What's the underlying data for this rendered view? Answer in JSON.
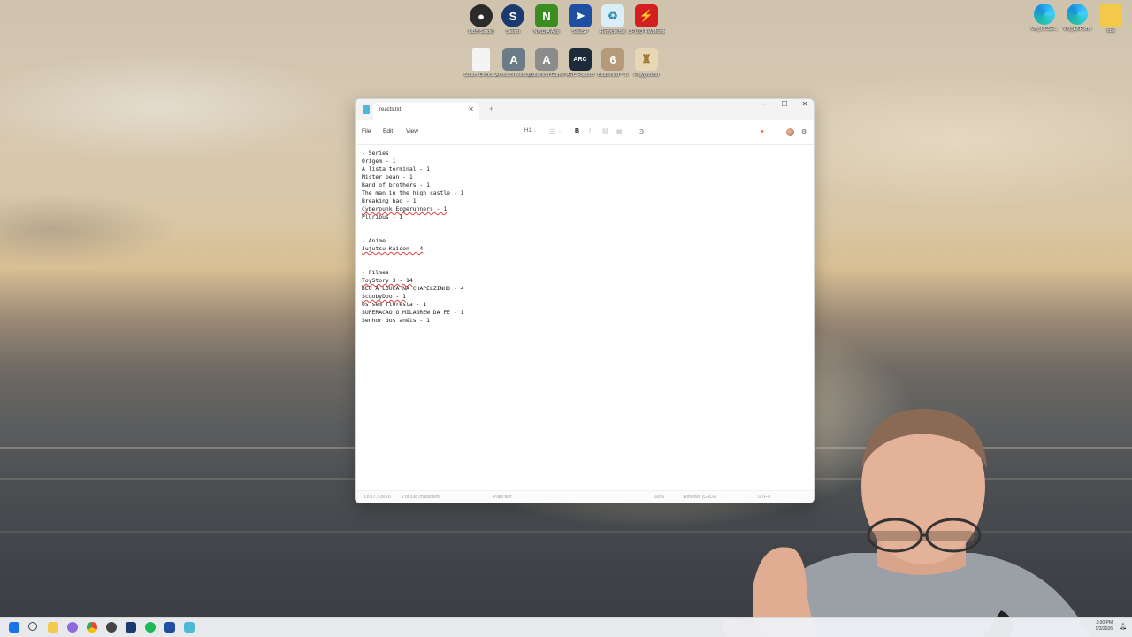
{
  "desktop": {
    "top_icons": [
      {
        "label": "OBS Studio",
        "icon": "obs-icon",
        "color": "#2b2b2b"
      },
      {
        "label": "Steam",
        "icon": "steam-icon",
        "color": "#1b3b6f"
      },
      {
        "label": "NVIDIA App",
        "icon": "nvidia-icon",
        "color": "#3a8d1f"
      },
      {
        "label": "SoulSP",
        "icon": "app-icon",
        "color": "#1e4fa3"
      },
      {
        "label": "Recycle Bin",
        "icon": "recycle-bin-icon",
        "color": "#d9eef7"
      },
      {
        "label": "CPUID HWMonitor",
        "icon": "hwmonitor-icon",
        "color": "#d22020"
      }
    ],
    "second_row_icons": [
      {
        "label": "Steam Deckto...",
        "icon": "file-icon",
        "color": "#f4f4f4"
      },
      {
        "label": "Arena Breakout: Infinite",
        "icon": "game-icon",
        "color": "#6b7c86"
      },
      {
        "label": "Battlefield Game I...",
        "icon": "game-icon",
        "color": "#8c8c8c"
      },
      {
        "label": "ARC Raiders",
        "icon": "game-icon",
        "color": "#1c2a3a"
      },
      {
        "label": "Battlefield™ 6",
        "icon": "game-icon",
        "color": "#b59b7a"
      },
      {
        "label": "Playground",
        "icon": "game-icon",
        "color": "#e7d7b4"
      }
    ],
    "right_icons": [
      {
        "label": "VM_PCSE...",
        "icon": "edge-icon"
      },
      {
        "label": "VM_EKP.xml",
        "icon": "edge-icon"
      },
      {
        "label": "obs",
        "icon": "folder-icon"
      }
    ]
  },
  "notepad": {
    "tab_title": "reacts.txt",
    "menu": [
      "File",
      "Edit",
      "View"
    ],
    "toolbar": {
      "heading": "H1",
      "bold": "B",
      "italic": "I"
    },
    "lines": [
      {
        "text": "- Series"
      },
      {
        "text": "Origem - 1"
      },
      {
        "text": "A lista terminal - 1"
      },
      {
        "text": "Mister bean - 1"
      },
      {
        "text": "Band of brothers - 1"
      },
      {
        "text": "The man in the high castle - 1"
      },
      {
        "text": "Breaking bad - 1"
      },
      {
        "text": "Cyberpunk Edgerunners - 1"
      },
      {
        "text": "Pluribus - 1"
      },
      {
        "text": ""
      },
      {
        "text": ""
      },
      {
        "text": "- Anime"
      },
      {
        "text": "Jujutsu Kaisen - 4"
      },
      {
        "text": ""
      },
      {
        "text": ""
      },
      {
        "text": "- Filmes"
      },
      {
        "text": "ToyStory 3 - 14"
      },
      {
        "text": "DEU A LOUCA NA CHAPELZINHO - 4"
      },
      {
        "text": "ScoobyDoo - 1"
      },
      {
        "text": "Os sem floresta - 1"
      },
      {
        "text": "SUPERACAO O MILAGREW DA FE - 1"
      },
      {
        "text": "Senhor dos anéis - 1"
      }
    ],
    "status": {
      "position": "Ln 17, Col 16",
      "selection": "2 of 338 characters",
      "format": "Plain text",
      "zoom": "100%",
      "line_ending": "Windows (CRLF)",
      "encoding": "UTF-8"
    }
  },
  "taskbar": {
    "time": "2:00 PM",
    "date": "1/3/2026"
  }
}
